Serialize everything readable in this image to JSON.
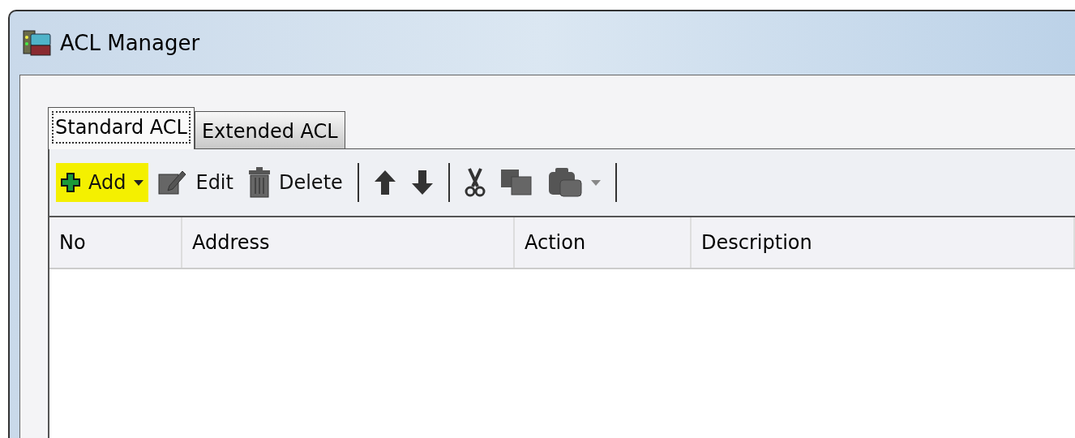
{
  "window": {
    "title": "ACL Manager"
  },
  "tabs": [
    {
      "label": "Standard ACL",
      "selected": true
    },
    {
      "label": "Extended ACL",
      "selected": false
    }
  ],
  "toolbar": [
    {
      "kind": "button",
      "label": "Add",
      "highlighted": true,
      "dropdown": true
    },
    {
      "kind": "button",
      "label": "Edit",
      "highlighted": false,
      "dropdown": false
    },
    {
      "kind": "button",
      "label": "Delete",
      "highlighted": false,
      "dropdown": false
    },
    {
      "kind": "separator"
    },
    {
      "kind": "icon",
      "highlighted": false,
      "dropdown": false
    },
    {
      "kind": "icon",
      "highlighted": false,
      "dropdown": false
    },
    {
      "kind": "separator"
    },
    {
      "kind": "icon",
      "highlighted": false,
      "dropdown": false
    },
    {
      "kind": "icon",
      "highlighted": false,
      "dropdown": false
    },
    {
      "kind": "icon",
      "highlighted": false,
      "dropdown": true
    },
    {
      "kind": "separator"
    }
  ],
  "table": {
    "columns": [
      "No",
      "Address",
      "Action",
      "Description"
    ]
  }
}
